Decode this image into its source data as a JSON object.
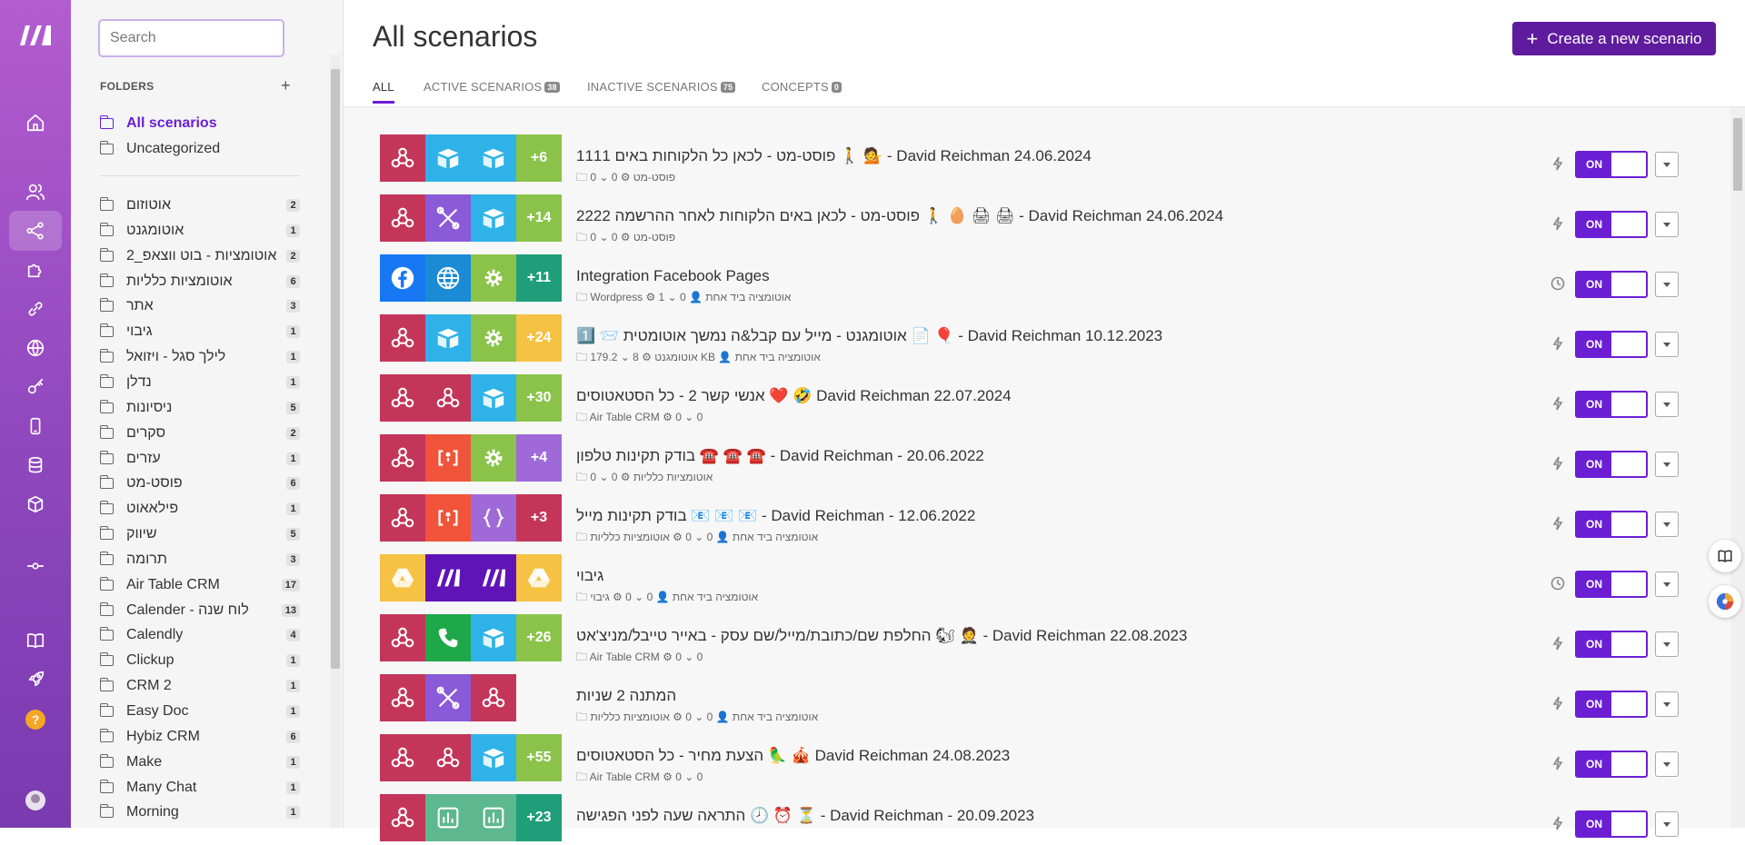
{
  "sidebar": {
    "search_placeholder": "Search",
    "folders_header": "FOLDERS",
    "add_folder": "+",
    "top_items": [
      {
        "label": "All scenarios"
      },
      {
        "label": "Uncategorized"
      }
    ],
    "folders": [
      {
        "label": "אוטוזום",
        "count": "2"
      },
      {
        "label": "אוטומגנט",
        "count": "1"
      },
      {
        "label": "אוטומציות - בוט ווצאפ_2",
        "count": "2"
      },
      {
        "label": "אוטומציות כלליות",
        "count": "6"
      },
      {
        "label": "אתר",
        "count": "3"
      },
      {
        "label": "גיבוי",
        "count": "1"
      },
      {
        "label": "לילך סגל - ויזואל",
        "count": "1"
      },
      {
        "label": "נדלן",
        "count": "1"
      },
      {
        "label": "ניסיונות",
        "count": "5"
      },
      {
        "label": "סקרים",
        "count": "2"
      },
      {
        "label": "עזרים",
        "count": "1"
      },
      {
        "label": "פוסט-מט",
        "count": "6"
      },
      {
        "label": "פילאאוט",
        "count": "1"
      },
      {
        "label": "שיווק",
        "count": "5"
      },
      {
        "label": "תרומה",
        "count": "3"
      },
      {
        "label": "Air Table CRM",
        "count": "17"
      },
      {
        "label": "Calender - לוח שנה",
        "count": "13"
      },
      {
        "label": "Calendly",
        "count": "4"
      },
      {
        "label": "Clickup",
        "count": "1"
      },
      {
        "label": "CRM 2",
        "count": "1"
      },
      {
        "label": "Easy Doc",
        "count": "1"
      },
      {
        "label": "Hybiz CRM",
        "count": "6"
      },
      {
        "label": "Make",
        "count": "1"
      },
      {
        "label": "Many Chat",
        "count": "1"
      },
      {
        "label": "Morning",
        "count": "1"
      }
    ]
  },
  "header": {
    "title": "All scenarios",
    "create_button": "Create a new scenario",
    "tabs": [
      {
        "label": "ALL",
        "count": ""
      },
      {
        "label": "ACTIVE SCENARIOS",
        "count": "38"
      },
      {
        "label": "INACTIVE SCENARIOS",
        "count": "75"
      },
      {
        "label": "CONCEPTS",
        "count": "0"
      }
    ]
  },
  "colors": {
    "accent": "#6b1fd4",
    "create_button": "#5f1b9e",
    "webhook": "#c4355a",
    "airtable": "#2fb2e8",
    "tools": "#8a5ad8",
    "facebook": "#1877f2",
    "http": "#1a8bd4",
    "green": "#8bc34a",
    "teal": "#1f9e79",
    "yellow": "#f5c243",
    "orange": "#f0843a",
    "purple_count": "#9f6ad8",
    "phone": "#1fa84a",
    "make": "#6014b8"
  },
  "scenarios": [
    {
      "title": "1111 פוסט-מט - לכאן כל הלקוחות באים 🚶 💁 - David Reichman 24.06.2024",
      "meta": "🗀 0 ⌄ 0  ⚙ פוסט-מט",
      "extra": "+6",
      "trigger": "instant",
      "toggle": "ON",
      "tiles": [
        {
          "icon": "webhook-icon",
          "color": "#c4355a"
        },
        {
          "icon": "airtable-icon",
          "color": "#2fb2e8"
        },
        {
          "icon": "airtable-icon",
          "color": "#2fb2e8"
        }
      ],
      "extra_color": "#8bc34a"
    },
    {
      "title": "2222 פוסט-מט - לכאן באים הלקוחות לאחר ההרשמה 🚶 🥚 🖨 🖨 - David Reichman 24.06.2024",
      "meta": "🗀 0 ⌄ 0  ⚙ פוסט-מט",
      "extra": "+14",
      "trigger": "instant",
      "toggle": "ON",
      "tiles": [
        {
          "icon": "webhook-icon",
          "color": "#c4355a"
        },
        {
          "icon": "tools-icon",
          "color": "#8a5ad8"
        },
        {
          "icon": "airtable-icon",
          "color": "#2fb2e8"
        }
      ],
      "extra_color": "#8bc34a"
    },
    {
      "title": "Integration Facebook Pages",
      "meta": "🗀 Wordpress  ⚙ 1 ⌄ 0  👤 אוטומציה ביד אחת",
      "extra": "+11",
      "trigger": "scheduled",
      "toggle": "ON",
      "tiles": [
        {
          "icon": "facebook-icon",
          "color": "#1877f2"
        },
        {
          "icon": "http-icon",
          "color": "#1a8bd4"
        },
        {
          "icon": "gear-icon",
          "color": "#8bc34a"
        }
      ],
      "extra_color": "#1f9e79"
    },
    {
      "title": "1️⃣ 📨 אוטומגנט - מייל עם קבל&ה נמשך אוטומטית 📄 🎈 - David Reichman 10.12.2023",
      "meta": "🗀 179.2 ⌄ 8  ⚙ אוטומגנט  KB  👤 אוטומציה ביד אחת",
      "extra": "+24",
      "trigger": "instant",
      "toggle": "ON",
      "tiles": [
        {
          "icon": "webhook-icon",
          "color": "#c4355a"
        },
        {
          "icon": "airtable-icon",
          "color": "#2fb2e8"
        },
        {
          "icon": "gear-icon",
          "color": "#8bc34a"
        }
      ],
      "extra_color": "#f5c243"
    },
    {
      "title": "אנשי קשר 2 - כל הסטאטוסים ❤️ 🤣 David Reichman 22.07.2024",
      "meta": "🗀 Air Table CRM  ⚙ 0 ⌄ 0",
      "extra": "+30",
      "trigger": "instant",
      "toggle": "ON",
      "tiles": [
        {
          "icon": "webhook-icon",
          "color": "#c4355a"
        },
        {
          "icon": "webhook-icon",
          "color": "#c4355a"
        },
        {
          "icon": "airtable-icon",
          "color": "#2fb2e8"
        }
      ],
      "extra_color": "#8bc34a"
    },
    {
      "title": "בודק תקינות טלפון ☎️ ☎️ ☎️ - David Reichman - 20.06.2022",
      "meta": "🗀 0 ⌄ 0  ⚙ אוטומציות כלליות",
      "extra": "+4",
      "trigger": "instant",
      "toggle": "ON",
      "tiles": [
        {
          "icon": "webhook-icon",
          "color": "#c4355a"
        },
        {
          "icon": "array-icon",
          "color": "#f0543a"
        },
        {
          "icon": "gear-icon",
          "color": "#8bc34a"
        }
      ],
      "extra_color": "#9f6ad8"
    },
    {
      "title": "בודק תקינות מייל 📧 📧 📧 - David Reichman - 12.06.2022",
      "meta": "🗀 אוטומציה ביד אחת  👤 0 ⌄ 0  ⚙ אוטומציות כלליות",
      "extra": "+3",
      "trigger": "instant",
      "toggle": "ON",
      "tiles": [
        {
          "icon": "webhook-icon",
          "color": "#c4355a"
        },
        {
          "icon": "array-icon",
          "color": "#f0543a"
        },
        {
          "icon": "json-icon",
          "color": "#9f6ad8"
        }
      ],
      "extra_color": "#c4355a"
    },
    {
      "title": "גיבוי",
      "meta": "🗀 אוטומציה ביד אחת  👤 0 ⌄ 0  ⚙ גיבוי",
      "extra": "",
      "trigger": "scheduled",
      "toggle": "ON",
      "tiles": [
        {
          "icon": "google-drive-icon",
          "color": "#f5c243"
        },
        {
          "icon": "make-icon",
          "color": "#6014b8"
        },
        {
          "icon": "make-icon",
          "color": "#6014b8"
        },
        {
          "icon": "google-drive-icon",
          "color": "#f5c243"
        }
      ],
      "extra_color": ""
    },
    {
      "title": "החלפת שם/כתובת/מייל/שם עסק - באייר טייבל/מניצ'אט 🐿 🤵 - David Reichman 22.08.2023",
      "meta": "🗀 Air Table CRM  ⚙ 0 ⌄ 0",
      "extra": "+26",
      "trigger": "instant",
      "toggle": "ON",
      "tiles": [
        {
          "icon": "webhook-icon",
          "color": "#c4355a"
        },
        {
          "icon": "phone-icon",
          "color": "#1fa84a"
        },
        {
          "icon": "airtable-icon",
          "color": "#2fb2e8"
        }
      ],
      "extra_color": "#8bc34a"
    },
    {
      "title": "המתנה 2 שניות",
      "meta": "🗀 אוטומציה ביד אחת  👤 0 ⌄ 0  ⚙ אוטומציות כלליות",
      "extra": "",
      "trigger": "instant",
      "toggle": "ON",
      "tiles": [
        {
          "icon": "webhook-icon",
          "color": "#c4355a"
        },
        {
          "icon": "tools-icon",
          "color": "#8a5ad8"
        },
        {
          "icon": "webhook-icon",
          "color": "#c4355a"
        }
      ],
      "extra_color": ""
    },
    {
      "title": "הצעת מחיר - כל הסטאטוסים 🦜 🎪 David Reichman 24.08.2023",
      "meta": "🗀 Air Table CRM  ⚙ 0 ⌄ 0",
      "extra": "+55",
      "trigger": "instant",
      "toggle": "ON",
      "tiles": [
        {
          "icon": "webhook-icon",
          "color": "#c4355a"
        },
        {
          "icon": "webhook-icon",
          "color": "#c4355a"
        },
        {
          "icon": "airtable-icon",
          "color": "#2fb2e8"
        }
      ],
      "extra_color": "#8bc34a"
    },
    {
      "title": "התראה שעה לפני הפגישה 🕗 ⏰ ⏳  - David Reichman - 20.09.2023",
      "meta": "",
      "extra": "+23",
      "trigger": "instant",
      "toggle": "ON",
      "tiles": [
        {
          "icon": "webhook-icon",
          "color": "#c4355a"
        },
        {
          "icon": "chart-icon",
          "color": "#5db88f"
        },
        {
          "icon": "chart-icon",
          "color": "#5db88f"
        }
      ],
      "extra_color": "#1f9e79"
    }
  ]
}
